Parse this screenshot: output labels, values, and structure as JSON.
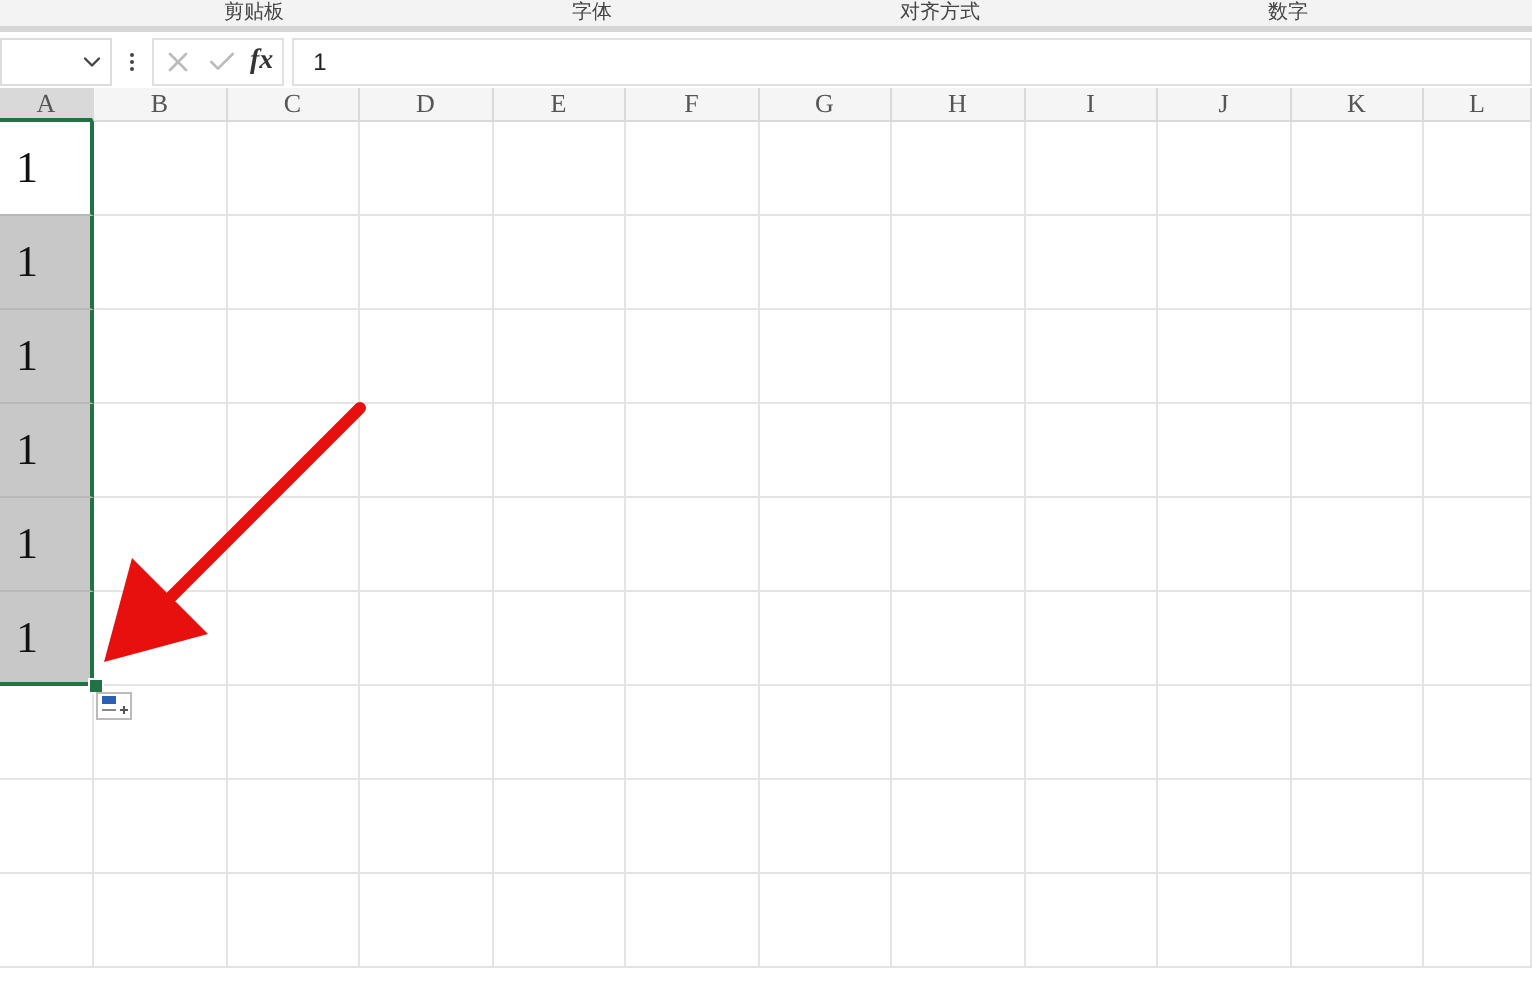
{
  "ribbon_groups": [
    "剪贴板",
    "字体",
    "对齐方式",
    "数字"
  ],
  "formula_bar": {
    "function_label": "fx",
    "value": "1"
  },
  "columns": [
    "A",
    "B",
    "C",
    "D",
    "E",
    "F",
    "G",
    "H",
    "I",
    "J",
    "K",
    "L"
  ],
  "rows": [
    {
      "value": "1",
      "selected": true,
      "active": true
    },
    {
      "value": "1",
      "selected": true,
      "active": false
    },
    {
      "value": "1",
      "selected": true,
      "active": false
    },
    {
      "value": "1",
      "selected": true,
      "active": false
    },
    {
      "value": "1",
      "selected": true,
      "active": false
    },
    {
      "value": "1",
      "selected": true,
      "active": false
    },
    {
      "selected": false
    },
    {
      "selected": false
    },
    {
      "selected": false
    }
  ]
}
